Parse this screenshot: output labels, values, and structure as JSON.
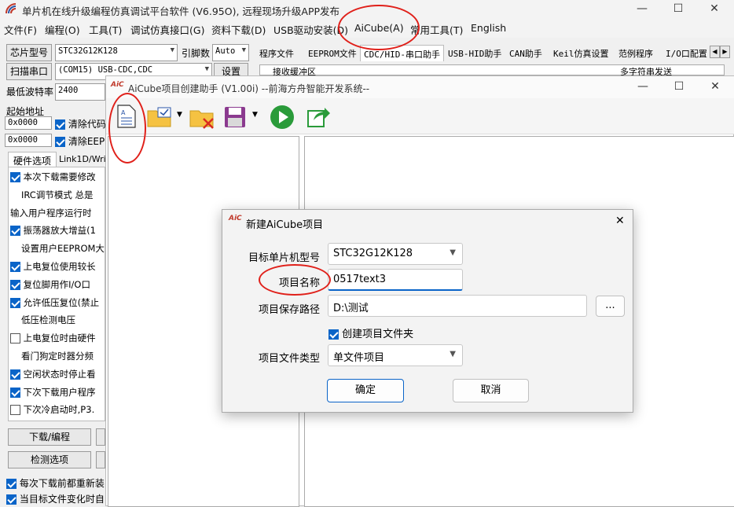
{
  "window": {
    "title": "单片机在线升级编程仿真调试平台软件 (V6.95O), 远程现场升级APP发布",
    "min": "—",
    "max": "☐",
    "close": "✕"
  },
  "menu": [
    "文件(F)",
    "编程(O)",
    "工具(T)",
    "调试仿真接口(G)",
    "资料下载(D)",
    "USB驱动安装(D)",
    "AiCube(A)",
    "常用工具(T)",
    "English"
  ],
  "left": {
    "chip_label": "芯片型号",
    "chip_value": "STC32G12K128",
    "pins_label": "引脚数",
    "pins_value": "Auto",
    "scan_label": "扫描串口",
    "port_value": "(COM15) USB-CDC,CDC",
    "settings_btn": "设置",
    "baud_label": "最低波特率",
    "baud_value": "2400",
    "start_addr_label": "起始地址",
    "addr1": "0x0000",
    "clear_code": "清除代码",
    "addr2": "0x0000",
    "clear_eeprom": "清除EEPR",
    "hw_tab": "硬件选项",
    "link_tab": "Link1D/Wri",
    "options": [
      {
        "text": "本次下载需要修改",
        "checked": true
      },
      {
        "text": "IRC调节模式  总是",
        "checked": null
      },
      {
        "text": "输入用户程序运行时",
        "checked": null
      },
      {
        "text": "振荡器放大增益(1",
        "checked": true
      },
      {
        "text": "设置用户EEPROM大",
        "checked": null
      },
      {
        "text": "上电复位使用较长",
        "checked": true
      },
      {
        "text": "复位脚用作I/O口",
        "checked": true
      },
      {
        "text": "允许低压复位(禁止",
        "checked": true
      },
      {
        "text": "低压检测电压",
        "checked": null
      },
      {
        "text": "上电复位时由硬件",
        "checked": false
      },
      {
        "text": "看门狗定时器分频",
        "checked": null
      },
      {
        "text": "空闲状态时停止看",
        "checked": true
      },
      {
        "text": "下次下载用户程序",
        "checked": true
      },
      {
        "text": "下次冷启动时,P3.",
        "checked": false
      }
    ],
    "download_btn": "下载/编程",
    "detect_btn": "检测选项",
    "reload1": "每次下载前都重新装",
    "reload2": "当目标文件变化时自"
  },
  "tabs": [
    "程序文件",
    "EEPROM文件",
    "CDC/HID-串口助手",
    "USB-HID助手",
    "CAN助手",
    "Keil仿真设置",
    "范例程序",
    "I/O口配置"
  ],
  "tabs_sub": {
    "recv": "接收缓冲区",
    "multi": "多字符串发送"
  },
  "aicube": {
    "title": "AiCube项目创建助手 (V1.00i) --前海方舟智能开发系统--"
  },
  "dialog": {
    "title": "新建AiCube项目",
    "mcu_label": "目标单片机型号",
    "mcu_value": "STC32G12K128",
    "name_label": "项目名称",
    "name_value": "0517text3",
    "path_label": "项目保存路径",
    "path_value": "D:\\测试",
    "browse": "...",
    "create_folder": "创建项目文件夹",
    "type_label": "项目文件类型",
    "type_value": "单文件项目",
    "ok": "确定",
    "cancel": "取消"
  }
}
